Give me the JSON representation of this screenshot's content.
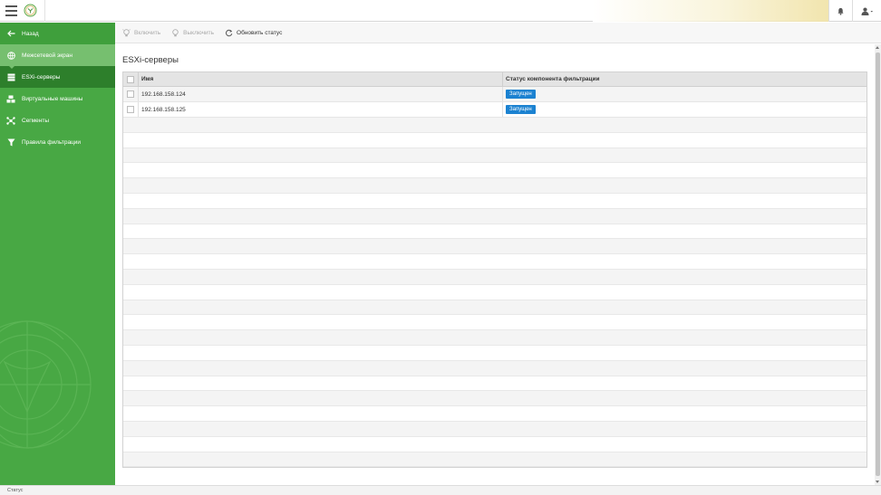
{
  "header": {
    "menu_icon": "hamburger-icon",
    "logo_icon": "shield-logo-icon",
    "notifications_icon": "bell-icon",
    "user_icon": "user-icon"
  },
  "sidebar": {
    "items": [
      {
        "label": "Назад",
        "icon": "arrow-left-icon"
      },
      {
        "label": "Межсетевой экран",
        "icon": "firewall-icon"
      },
      {
        "label": "ESXi-серверы",
        "icon": "server-icon"
      },
      {
        "label": "Виртуальные машины",
        "icon": "virtual-machines-icon"
      },
      {
        "label": "Сегменты",
        "icon": "segments-icon"
      },
      {
        "label": "Правила фильтрации",
        "icon": "filter-icon"
      }
    ]
  },
  "toolbar": {
    "enable_label": "Включить",
    "disable_label": "Выключить",
    "refresh_label": "Обновить статус"
  },
  "main": {
    "title": "ESXi-серверы",
    "columns": {
      "name": "Имя",
      "status": "Статус компонента фильтрации"
    },
    "rows": [
      {
        "name": "192.168.158.124",
        "status": "Запущен"
      },
      {
        "name": "192.168.158.125",
        "status": "Запущен"
      }
    ]
  },
  "statusbar": {
    "text": "Статус"
  },
  "colors": {
    "sidebar_bg": "#48a844",
    "sidebar_active": "#2d7f2b",
    "sidebar_highlight": "#76bf6f",
    "status_badge": "#1b82d1"
  }
}
